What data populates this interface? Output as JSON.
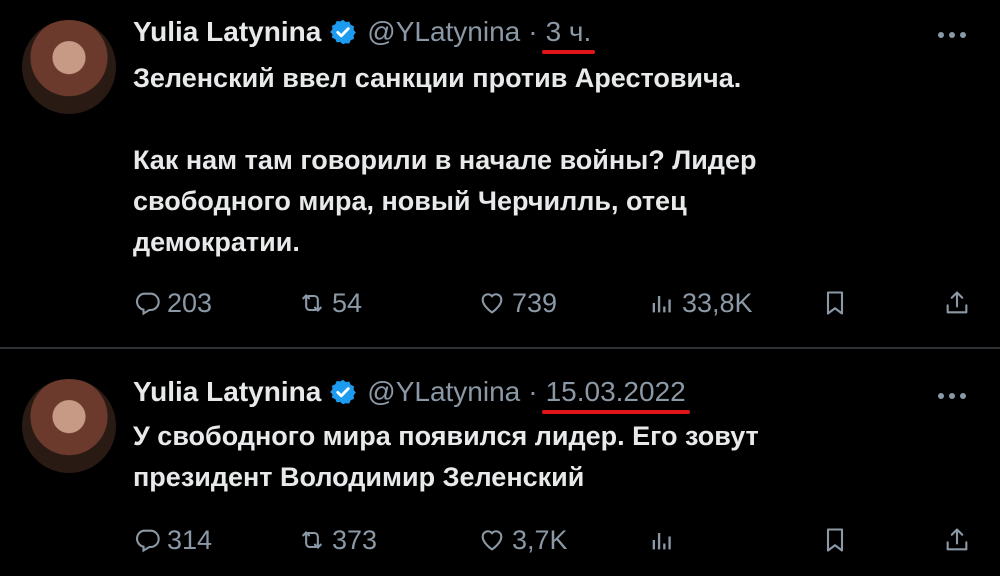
{
  "tweets": [
    {
      "author": {
        "name": "Yulia Latynina",
        "handle": "@YLatynina"
      },
      "time": "3 ч.",
      "paragraphs": [
        [
          "Зеленский ввел санкции против Арестовича."
        ],
        [
          "Как нам там говорили в начале войны? Лидер",
          "свободного мира, новый Черчилль, отец",
          "демократии."
        ]
      ],
      "stats": {
        "replies": "203",
        "retweets": "54",
        "likes": "739",
        "views": "33,8K"
      }
    },
    {
      "author": {
        "name": "Yulia Latynina",
        "handle": "@YLatynina"
      },
      "time": "15.03.2022",
      "paragraphs": [
        [
          "У свободного мира появился лидер. Его зовут",
          "президент Володимир Зеленский"
        ]
      ],
      "stats": {
        "replies": "314",
        "retweets": "373",
        "likes": "3,7K",
        "views": ""
      }
    }
  ],
  "separator": "·",
  "icons": [
    "verified-badge-icon",
    "more-icon",
    "reply-icon",
    "retweet-icon",
    "like-icon",
    "views-icon",
    "bookmark-icon",
    "share-icon"
  ],
  "colors": {
    "background": "#000000",
    "text": "#e7e9ea",
    "muted": "#8b98a5",
    "verified": "#1d9bf0",
    "underline": "#e0161b"
  }
}
